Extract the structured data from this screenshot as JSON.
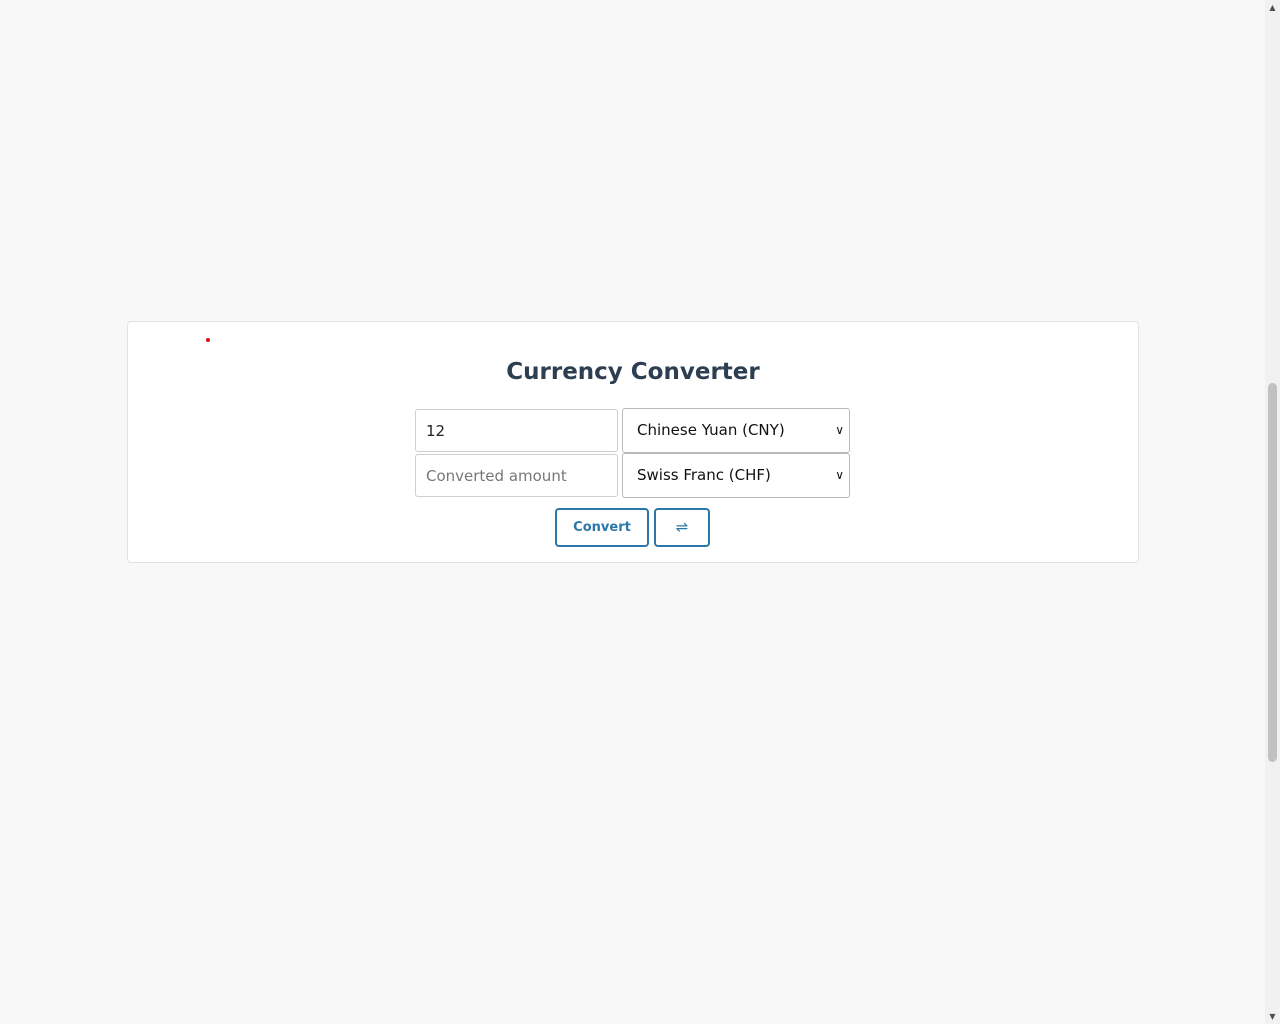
{
  "title": "Currency Converter",
  "amount_input": {
    "value": "12"
  },
  "converted_input": {
    "placeholder": "Converted amount",
    "value": ""
  },
  "from_currency": {
    "selected": "Chinese Yuan (CNY)"
  },
  "to_currency": {
    "selected": "Swiss Franc (CHF)"
  },
  "buttons": {
    "convert": "Convert",
    "swap": "⇌"
  },
  "colors": {
    "accent": "#2b78a8",
    "title": "#2c3e50",
    "background": "#f8f8f8"
  },
  "icons": {
    "chevron": "chevron-down-icon",
    "swap": "swap-arrows-icon"
  }
}
